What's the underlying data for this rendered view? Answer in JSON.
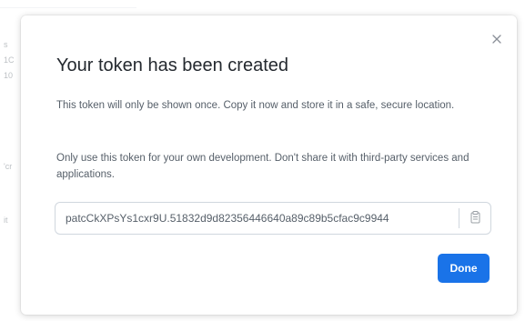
{
  "background": {
    "fragments": [
      "s",
      "1C",
      "10",
      "'cr",
      "it"
    ]
  },
  "dialog": {
    "title": "Your token has been created",
    "close_icon": "close-icon",
    "paragraph_1": "This token will only be shown once. Copy it now and store it in a safe, secure location.",
    "paragraph_2": "Only use this token for your own development. Don't share it with third-party services and applications.",
    "token_value": "patcCkXPsYs1cxr9U.51832d9d82356446640a89c89b5cfac9c9944",
    "copy_icon": "copy-icon",
    "done_label": "Done"
  },
  "colors": {
    "primary_button": "#1a73e8",
    "title_text": "#24292f",
    "body_text": "#57606a"
  }
}
